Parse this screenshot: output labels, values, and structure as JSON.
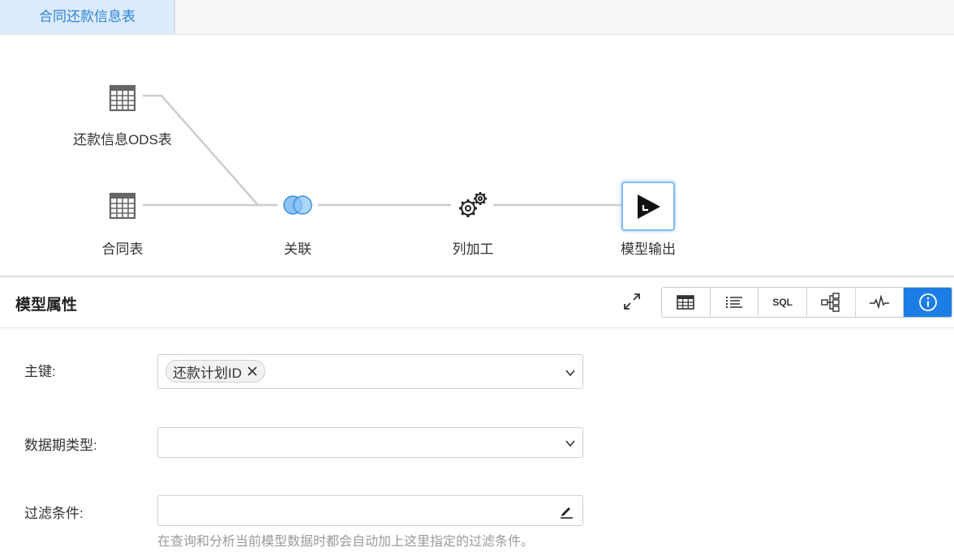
{
  "tabs": [
    {
      "label": "合同还款信息表",
      "active": true
    }
  ],
  "flow": {
    "nodes": [
      {
        "id": "repay-ods",
        "label": "还款信息ODS表",
        "icon": "table-icon"
      },
      {
        "id": "contract",
        "label": "合同表",
        "icon": "table-icon"
      },
      {
        "id": "join",
        "label": "关联",
        "icon": "join-circles-icon"
      },
      {
        "id": "column-process",
        "label": "列加工",
        "icon": "gears-icon"
      },
      {
        "id": "model-output",
        "label": "模型输出",
        "icon": "output-play-icon",
        "selected": true
      }
    ]
  },
  "properties": {
    "title": "模型属性",
    "toolbar": [
      {
        "name": "table-view",
        "icon": "grid-table-icon"
      },
      {
        "name": "list-view",
        "icon": "list-icon"
      },
      {
        "name": "sql-view",
        "label": "SQL"
      },
      {
        "name": "lineage-view",
        "icon": "hierarchy-icon"
      },
      {
        "name": "stats-view",
        "icon": "pulse-icon"
      },
      {
        "name": "info-view",
        "icon": "info-icon",
        "active": true
      }
    ],
    "fields": {
      "primary_key": {
        "label": "主键:",
        "tags": [
          "还款计划ID"
        ]
      },
      "period_type": {
        "label": "数据期类型:",
        "value": ""
      },
      "filter": {
        "label": "过滤条件:",
        "value": "",
        "hint": "在查询和分析当前模型数据时都会自动加上这里指定的过滤条件。"
      }
    }
  },
  "colors": {
    "accent": "#1c7de6",
    "tab_bg": "#dcebfb",
    "tab_text": "#2f84d8",
    "edge": "#cccccc",
    "join_fill": "#8cc4f5"
  }
}
